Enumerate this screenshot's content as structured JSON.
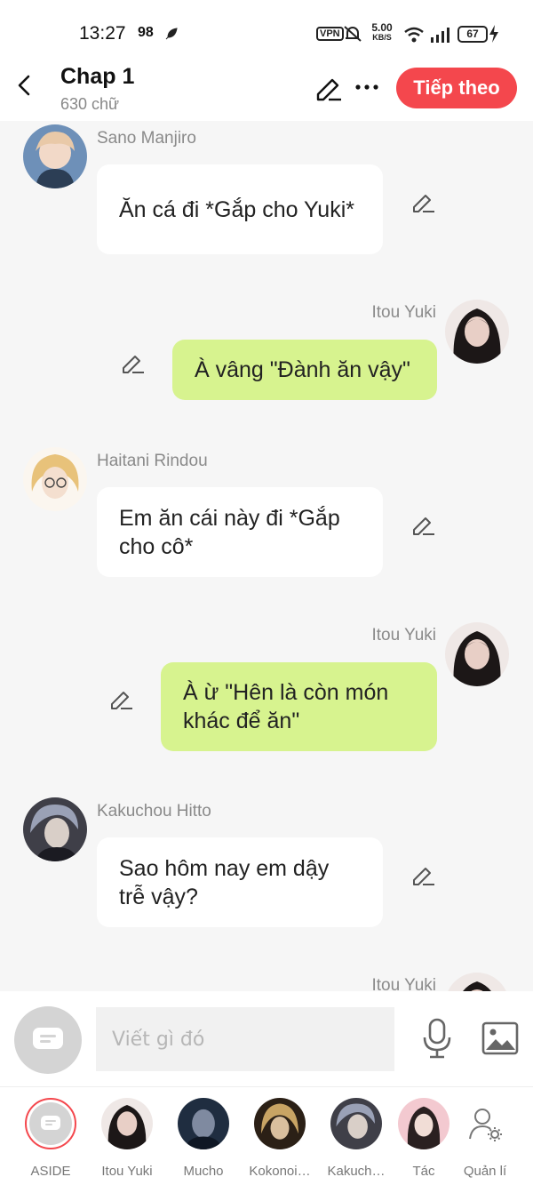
{
  "status_bar": {
    "time": "13:27",
    "indicator": "98",
    "vpn": "VPN",
    "speed_value": "5.00",
    "speed_unit": "KB/S",
    "battery": "67"
  },
  "header": {
    "title": "Chap 1",
    "subtitle": "630 chữ",
    "next_label": "Tiếp theo"
  },
  "messages": [
    {
      "side": "left",
      "name": "Sano Manjiro",
      "text": "Ăn cá đi *Gắp cho Yuki*"
    },
    {
      "side": "right",
      "name": "Itou Yuki",
      "text": "À vâng \"Đành ăn vậy\""
    },
    {
      "side": "left",
      "name": "Haitani Rindou",
      "text": "Em ăn cái này đi *Gắp cho cô*"
    },
    {
      "side": "right",
      "name": "Itou Yuki",
      "text": "À ừ \"Hên là còn món khác để ăn\""
    },
    {
      "side": "left",
      "name": "Kakuchou Hitto",
      "text": "Sao hôm nay em dậy trễ vậy?"
    },
    {
      "side": "right",
      "name": "Itou Yuki",
      "text": ""
    }
  ],
  "input": {
    "placeholder": "Viết gì đó"
  },
  "tabs": [
    {
      "label": "ASIDE"
    },
    {
      "label": "Itou Yuki"
    },
    {
      "label": "Mucho"
    },
    {
      "label": "Kokonoi…"
    },
    {
      "label": "Kakuch…"
    },
    {
      "label": "Tác"
    },
    {
      "label": "Quản lí"
    }
  ],
  "colors": {
    "accent": "#f4474d",
    "right_bubble": "#d7f38f",
    "left_bubble": "#ffffff",
    "background": "#f6f6f6"
  },
  "icons": [
    "back-arrow-icon",
    "pen-icon",
    "more-icon",
    "edit-icon",
    "message-icon",
    "mic-icon",
    "image-icon",
    "user-settings-icon"
  ]
}
